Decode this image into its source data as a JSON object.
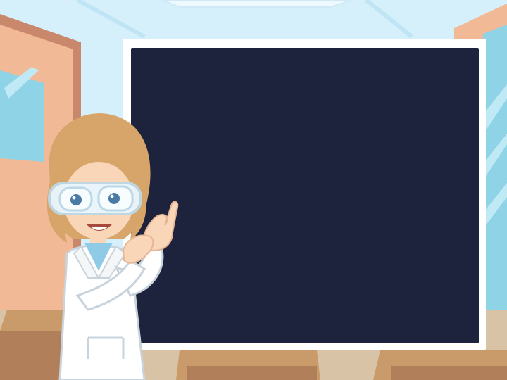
{
  "scene": {
    "background_color": "#cfeefb",
    "wall_color": "#d7f1fb",
    "door_color": "#f1b995",
    "window_color": "#8fd3e6",
    "desk_color": "#c99a6a",
    "board_frame_color": "#ffffff",
    "board_color": "#1d233c"
  },
  "blackboard": {
    "text": ""
  },
  "character": {
    "description_icon": "scientist-girl-icon",
    "coat_color": "#ffffff",
    "hair_color": "#d7a46a",
    "goggles_color": "#e9f7ff"
  }
}
